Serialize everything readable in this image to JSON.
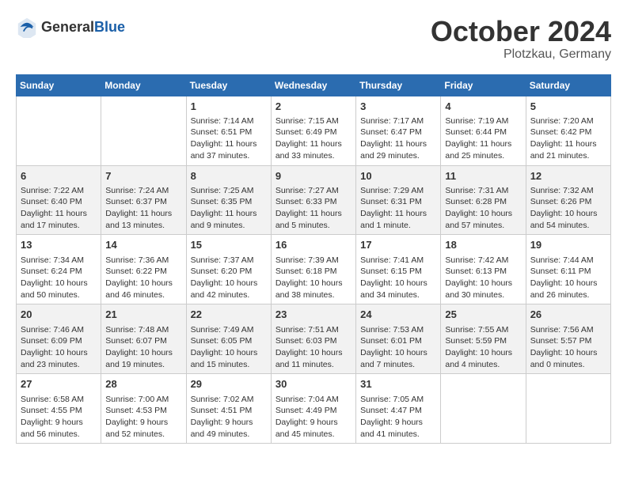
{
  "logo": {
    "general": "General",
    "blue": "Blue"
  },
  "title": {
    "month": "October 2024",
    "location": "Plotzkau, Germany"
  },
  "weekdays": [
    "Sunday",
    "Monday",
    "Tuesday",
    "Wednesday",
    "Thursday",
    "Friday",
    "Saturday"
  ],
  "weeks": [
    [
      {
        "day": "",
        "info": ""
      },
      {
        "day": "",
        "info": ""
      },
      {
        "day": "1",
        "info": "Sunrise: 7:14 AM\nSunset: 6:51 PM\nDaylight: 11 hours and 37 minutes."
      },
      {
        "day": "2",
        "info": "Sunrise: 7:15 AM\nSunset: 6:49 PM\nDaylight: 11 hours and 33 minutes."
      },
      {
        "day": "3",
        "info": "Sunrise: 7:17 AM\nSunset: 6:47 PM\nDaylight: 11 hours and 29 minutes."
      },
      {
        "day": "4",
        "info": "Sunrise: 7:19 AM\nSunset: 6:44 PM\nDaylight: 11 hours and 25 minutes."
      },
      {
        "day": "5",
        "info": "Sunrise: 7:20 AM\nSunset: 6:42 PM\nDaylight: 11 hours and 21 minutes."
      }
    ],
    [
      {
        "day": "6",
        "info": "Sunrise: 7:22 AM\nSunset: 6:40 PM\nDaylight: 11 hours and 17 minutes."
      },
      {
        "day": "7",
        "info": "Sunrise: 7:24 AM\nSunset: 6:37 PM\nDaylight: 11 hours and 13 minutes."
      },
      {
        "day": "8",
        "info": "Sunrise: 7:25 AM\nSunset: 6:35 PM\nDaylight: 11 hours and 9 minutes."
      },
      {
        "day": "9",
        "info": "Sunrise: 7:27 AM\nSunset: 6:33 PM\nDaylight: 11 hours and 5 minutes."
      },
      {
        "day": "10",
        "info": "Sunrise: 7:29 AM\nSunset: 6:31 PM\nDaylight: 11 hours and 1 minute."
      },
      {
        "day": "11",
        "info": "Sunrise: 7:31 AM\nSunset: 6:28 PM\nDaylight: 10 hours and 57 minutes."
      },
      {
        "day": "12",
        "info": "Sunrise: 7:32 AM\nSunset: 6:26 PM\nDaylight: 10 hours and 54 minutes."
      }
    ],
    [
      {
        "day": "13",
        "info": "Sunrise: 7:34 AM\nSunset: 6:24 PM\nDaylight: 10 hours and 50 minutes."
      },
      {
        "day": "14",
        "info": "Sunrise: 7:36 AM\nSunset: 6:22 PM\nDaylight: 10 hours and 46 minutes."
      },
      {
        "day": "15",
        "info": "Sunrise: 7:37 AM\nSunset: 6:20 PM\nDaylight: 10 hours and 42 minutes."
      },
      {
        "day": "16",
        "info": "Sunrise: 7:39 AM\nSunset: 6:18 PM\nDaylight: 10 hours and 38 minutes."
      },
      {
        "day": "17",
        "info": "Sunrise: 7:41 AM\nSunset: 6:15 PM\nDaylight: 10 hours and 34 minutes."
      },
      {
        "day": "18",
        "info": "Sunrise: 7:42 AM\nSunset: 6:13 PM\nDaylight: 10 hours and 30 minutes."
      },
      {
        "day": "19",
        "info": "Sunrise: 7:44 AM\nSunset: 6:11 PM\nDaylight: 10 hours and 26 minutes."
      }
    ],
    [
      {
        "day": "20",
        "info": "Sunrise: 7:46 AM\nSunset: 6:09 PM\nDaylight: 10 hours and 23 minutes."
      },
      {
        "day": "21",
        "info": "Sunrise: 7:48 AM\nSunset: 6:07 PM\nDaylight: 10 hours and 19 minutes."
      },
      {
        "day": "22",
        "info": "Sunrise: 7:49 AM\nSunset: 6:05 PM\nDaylight: 10 hours and 15 minutes."
      },
      {
        "day": "23",
        "info": "Sunrise: 7:51 AM\nSunset: 6:03 PM\nDaylight: 10 hours and 11 minutes."
      },
      {
        "day": "24",
        "info": "Sunrise: 7:53 AM\nSunset: 6:01 PM\nDaylight: 10 hours and 7 minutes."
      },
      {
        "day": "25",
        "info": "Sunrise: 7:55 AM\nSunset: 5:59 PM\nDaylight: 10 hours and 4 minutes."
      },
      {
        "day": "26",
        "info": "Sunrise: 7:56 AM\nSunset: 5:57 PM\nDaylight: 10 hours and 0 minutes."
      }
    ],
    [
      {
        "day": "27",
        "info": "Sunrise: 6:58 AM\nSunset: 4:55 PM\nDaylight: 9 hours and 56 minutes."
      },
      {
        "day": "28",
        "info": "Sunrise: 7:00 AM\nSunset: 4:53 PM\nDaylight: 9 hours and 52 minutes."
      },
      {
        "day": "29",
        "info": "Sunrise: 7:02 AM\nSunset: 4:51 PM\nDaylight: 9 hours and 49 minutes."
      },
      {
        "day": "30",
        "info": "Sunrise: 7:04 AM\nSunset: 4:49 PM\nDaylight: 9 hours and 45 minutes."
      },
      {
        "day": "31",
        "info": "Sunrise: 7:05 AM\nSunset: 4:47 PM\nDaylight: 9 hours and 41 minutes."
      },
      {
        "day": "",
        "info": ""
      },
      {
        "day": "",
        "info": ""
      }
    ]
  ]
}
